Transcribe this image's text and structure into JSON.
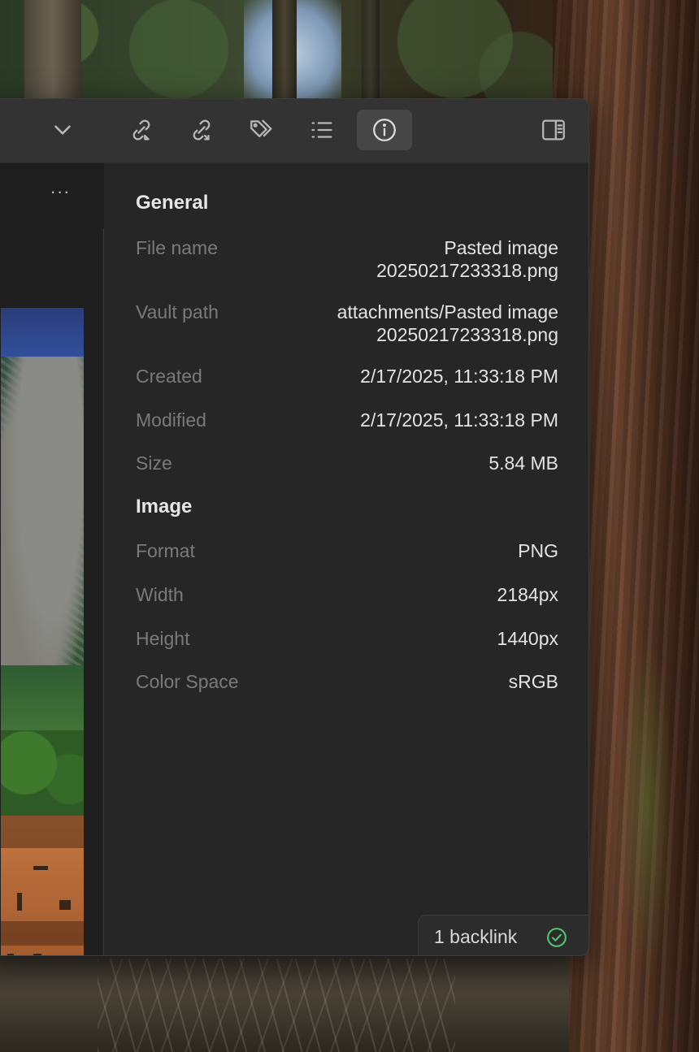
{
  "toolbar": {
    "icons": [
      "chevron-down-icon",
      "backlinks-icon",
      "outgoing-links-icon",
      "tags-icon",
      "outline-icon",
      "info-icon",
      "sidebar-toggle-icon"
    ],
    "active": "info-icon"
  },
  "editor": {
    "more_label": "···"
  },
  "info": {
    "general": {
      "title": "General",
      "file_name_label": "File name",
      "file_name_value": "Pasted image 20250217233318.png",
      "vault_path_label": "Vault path",
      "vault_path_value": "attachments/Pasted image 20250217233318.png",
      "created_label": "Created",
      "created_value": "2/17/2025, 11:33:18 PM",
      "modified_label": "Modified",
      "modified_value": "2/17/2025, 11:33:18 PM",
      "size_label": "Size",
      "size_value": "5.84 MB"
    },
    "image": {
      "title": "Image",
      "format_label": "Format",
      "format_value": "PNG",
      "width_label": "Width",
      "width_value": "2184px",
      "height_label": "Height",
      "height_value": "1440px",
      "color_space_label": "Color Space",
      "color_space_value": "sRGB"
    }
  },
  "status": {
    "backlinks_label": "1 backlink",
    "status_color": "#4fc36b"
  },
  "colors": {
    "window_bg": "#262626",
    "titlebar_bg": "#333333",
    "active_button_bg": "#464646",
    "label_text": "#7a7a7a",
    "value_text": "#e3e3e3"
  }
}
